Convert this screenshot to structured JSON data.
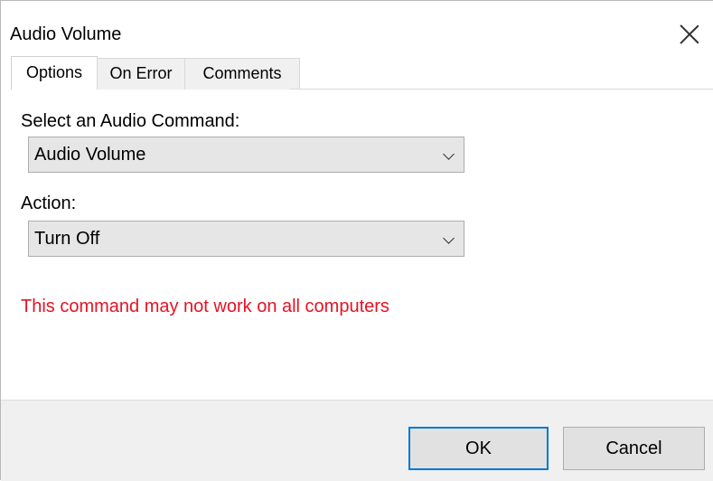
{
  "window": {
    "title": "Audio Volume"
  },
  "tabs": [
    {
      "label": "Options",
      "active": true
    },
    {
      "label": "On Error",
      "active": false
    },
    {
      "label": "Comments",
      "active": false
    }
  ],
  "form": {
    "command_label": "Select an Audio Command:",
    "command_value": "Audio Volume",
    "action_label": "Action:",
    "action_value": "Turn Off",
    "warning": "This command may not work on all computers"
  },
  "buttons": {
    "ok": "OK",
    "cancel": "Cancel"
  },
  "colors": {
    "warning": "#e81123",
    "focus_border": "#0078d7"
  }
}
